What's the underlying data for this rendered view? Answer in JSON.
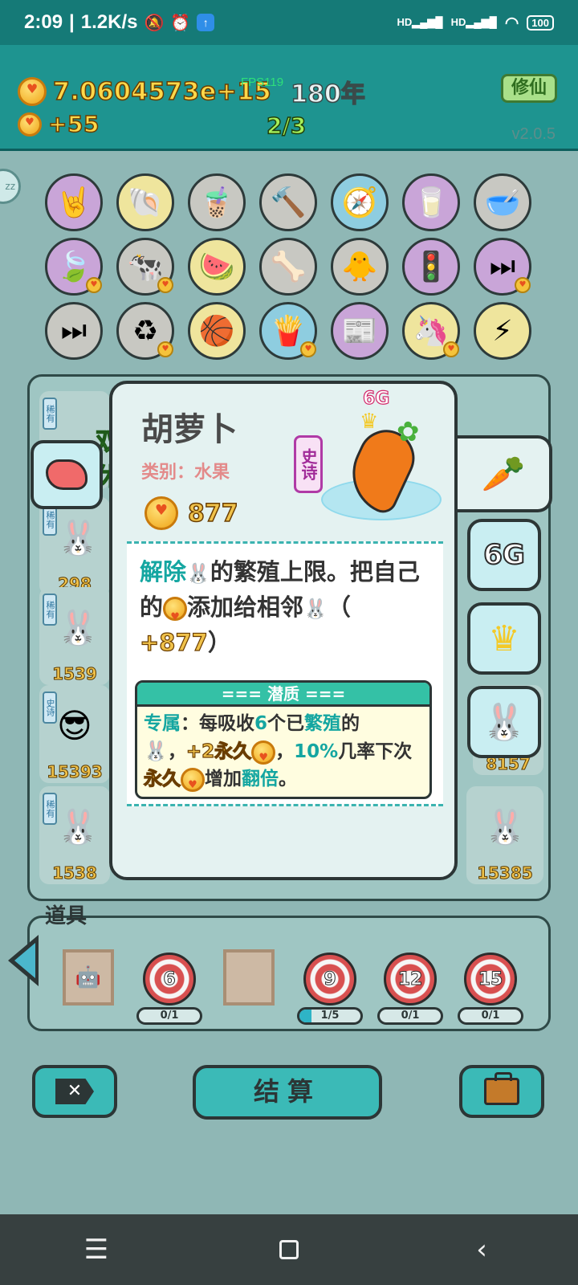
{
  "status_bar": {
    "time": "2:09",
    "speed": "1.2K/s",
    "hd1": "HD",
    "hd2": "HD",
    "battery": "100"
  },
  "header": {
    "money": "7.0604573e+15",
    "years": "180年",
    "fps": "FPS119",
    "income": "+55",
    "page": "2/3",
    "xiuxian_label": "修仙",
    "version": "v2.0.5"
  },
  "board": {
    "tag_rare": "稀有",
    "tag_epic": "史诗",
    "double_rest": "双休",
    "slot_values": [
      "298",
      "1539",
      "15393",
      "1538",
      "8157",
      "15385"
    ],
    "sixg_tag": "6G"
  },
  "card": {
    "title": "胡萝卜",
    "category": "类别：水果",
    "cost": "877",
    "rarity": "史诗",
    "sixg": "6G",
    "desc_part1": "解除",
    "desc_part2": "的繁殖上限。把自己的",
    "desc_part3": "添加给相邻",
    "desc_part4": "（",
    "desc_bonus": "+877",
    "desc_part5": "）",
    "trait_header": "=== 潜质 ===",
    "trait_label": "专属",
    "trait_text1": "：每吸收",
    "trait_num": "6",
    "trait_text2": "个已",
    "trait_breed": "繁殖",
    "trait_text3": "的",
    "trait_perm": "+2永久",
    "trait_text4": "，",
    "trait_pct": "10%",
    "trait_text5": "几率下次",
    "trait_perm2": "永久",
    "trait_text6": "增加",
    "trait_double": "翻倍",
    "trait_text7": "。"
  },
  "right_buttons": {
    "sixg": "6G"
  },
  "props": {
    "label": "道具",
    "targets": [
      {
        "num": "6",
        "progress": "0/1",
        "fraction": 0
      },
      {
        "num": "9",
        "progress": "1/5",
        "fraction": 0.2
      },
      {
        "num": "12",
        "progress": "0/1",
        "fraction": 0
      },
      {
        "num": "15",
        "progress": "0/1",
        "fraction": 0
      }
    ]
  },
  "actions": {
    "close": "✕",
    "settle": "结算"
  },
  "icons": {
    "items": [
      "rock-hand-icon",
      "shell-icon",
      "bubble-tea-icon",
      "hammer-icon",
      "compass-icon",
      "milk-jar-icon",
      "dog-bowl-icon",
      "leaf-icon",
      "cow-icon",
      "fruit-basket-icon",
      "dog-bowl-icon",
      "chick-icon",
      "traffic-light-icon",
      "skip-icon",
      "skip-icon",
      "recycle-icon",
      "basketballs-icon",
      "fries-icon",
      "time-magazine-icon",
      "unicorn-icon",
      "lightning-icon"
    ]
  }
}
